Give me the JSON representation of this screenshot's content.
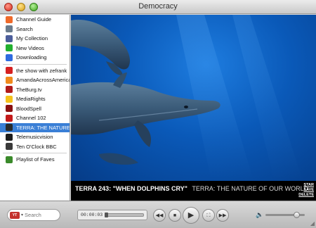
{
  "window": {
    "title": "Democracy"
  },
  "sidebar": {
    "items": [
      {
        "label": "Channel Guide",
        "icon": "channel-guide-icon",
        "color": "#ef6a2a"
      },
      {
        "label": "Search",
        "icon": "search-icon",
        "color": "#6a7b8c"
      },
      {
        "label": "My Collection",
        "icon": "collection-icon",
        "color": "#4c5e9b"
      },
      {
        "label": "New Videos",
        "icon": "new-videos-icon",
        "color": "#22b030"
      },
      {
        "label": "Downloading",
        "icon": "download-icon",
        "color": "#2e6be0"
      }
    ],
    "channels": [
      {
        "label": "the show with zefrank",
        "icon": "zefrank-icon",
        "color": "#d62020"
      },
      {
        "label": "AmandaAcrossAmerica",
        "icon": "rss-icon",
        "color": "#f08a1c"
      },
      {
        "label": "TheBurg.tv",
        "icon": "theburg-icon",
        "color": "#b01a1a"
      },
      {
        "label": "MediaRights",
        "icon": "mediarights-icon",
        "color": "#f4c21a"
      },
      {
        "label": "BloodSpell",
        "icon": "bloodspell-icon",
        "color": "#8a1010"
      },
      {
        "label": "Channel 102",
        "icon": "channel102-icon",
        "color": "#c41a1a"
      },
      {
        "label": "TERRA: THE NATURE",
        "icon": "terra-icon",
        "color": "#2a2a2a",
        "selected": true
      },
      {
        "label": "Telemusicvision",
        "icon": "telemusicvision-icon",
        "color": "#1d1d1d"
      },
      {
        "label": "Ten O'Clock BBC",
        "icon": "bbc-icon",
        "color": "#3a3a3a"
      }
    ],
    "playlists": [
      {
        "label": "Playlist of Faves",
        "icon": "playlist-icon",
        "color": "#3a8a2a"
      }
    ]
  },
  "video": {
    "title": "TERRA 243: \"WHEN DOLPHINS CRY\"",
    "subtitle": "TERRA: THE NATURE OF OUR WORLD",
    "actions": {
      "star": "STAR",
      "save": "SAVE",
      "delete": "DELETE"
    }
  },
  "toolbar": {
    "search_placeholder": "Search",
    "search_engine_label": "You Tube",
    "time": "00:00:03",
    "progress": 0.0,
    "volume": 0.78
  }
}
